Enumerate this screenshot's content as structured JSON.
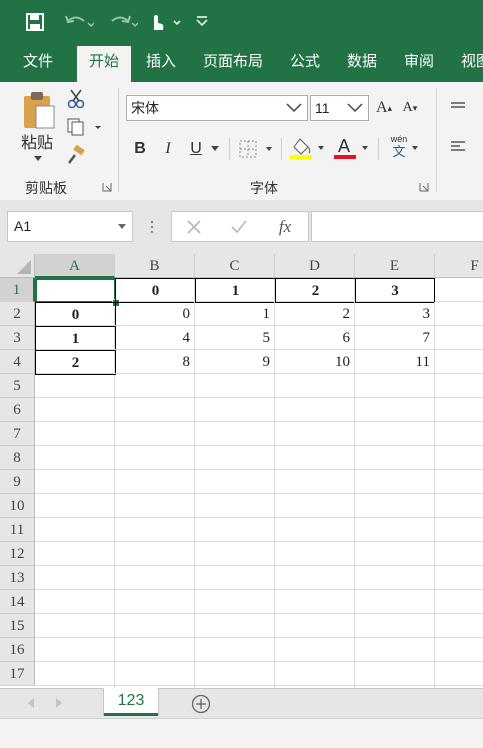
{
  "quick_access": [
    "save-icon",
    "undo-icon",
    "redo-icon",
    "touch-mode-icon",
    "customize-icon"
  ],
  "tabs": [
    "文件",
    "开始",
    "插入",
    "页面布局",
    "公式",
    "数据",
    "审阅",
    "视图"
  ],
  "active_tab": "开始",
  "clipboard": {
    "paste_label": "粘贴",
    "group_label": "剪贴板"
  },
  "font": {
    "name": "宋体",
    "size": "11",
    "group_label": "字体",
    "bold": "B",
    "italic": "I",
    "underline": "U",
    "font_color": "A",
    "wen": "wén",
    "wen_char": "文",
    "grow": "A",
    "shrink": "A"
  },
  "formula_bar": {
    "name_box": "A1",
    "fx": "fx",
    "formula": ""
  },
  "columns": [
    "A",
    "B",
    "C",
    "D",
    "E",
    "F"
  ],
  "rows": [
    "1",
    "2",
    "3",
    "4",
    "5",
    "6",
    "7",
    "8",
    "9",
    "10",
    "11",
    "12",
    "13",
    "14",
    "15",
    "16",
    "17"
  ],
  "cells": {
    "r1": [
      "",
      "0",
      "1",
      "2",
      "3"
    ],
    "r2": [
      "0",
      "0",
      "1",
      "2",
      "3"
    ],
    "r3": [
      "1",
      "4",
      "5",
      "6",
      "7"
    ],
    "r4": [
      "2",
      "8",
      "9",
      "10",
      "11"
    ]
  },
  "sheet_tab": "123",
  "colors": {
    "accent": "#217346",
    "font_color_bar": "#e81123",
    "highlight_bar": "#ffff00"
  }
}
